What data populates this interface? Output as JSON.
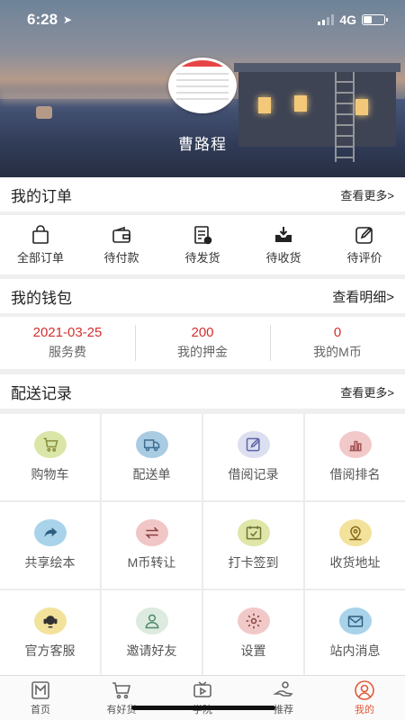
{
  "status_bar": {
    "time": "6:28",
    "network": "4G"
  },
  "profile": {
    "name": "曹路程"
  },
  "orders": {
    "title": "我的订单",
    "more": "查看更多>",
    "items": [
      {
        "label": "全部订单",
        "icon": "bag-icon"
      },
      {
        "label": "待付款",
        "icon": "wallet-icon"
      },
      {
        "label": "待发货",
        "icon": "shipping-list-icon"
      },
      {
        "label": "待收货",
        "icon": "inbox-download-icon"
      },
      {
        "label": "待评价",
        "icon": "edit-review-icon"
      }
    ]
  },
  "wallet": {
    "title": "我的钱包",
    "more": "查看明细>",
    "items": [
      {
        "value": "2021-03-25",
        "label": "服务费"
      },
      {
        "value": "200",
        "label": "我的押金"
      },
      {
        "value": "0",
        "label": "我的M币"
      }
    ]
  },
  "delivery": {
    "title": "配送记录",
    "more": "查看更多>",
    "items": [
      {
        "label": "购物车",
        "icon": "cart-icon",
        "color": "#d9e6a8"
      },
      {
        "label": "配送单",
        "icon": "truck-icon",
        "color": "#a9cce3"
      },
      {
        "label": "借阅记录",
        "icon": "pencil-icon",
        "color": "#dcdff0"
      },
      {
        "label": "借阅排名",
        "icon": "ranking-icon",
        "color": "#f2c9c9"
      },
      {
        "label": "共享绘本",
        "icon": "share-icon",
        "color": "#a9d3ea"
      },
      {
        "label": "M币转让",
        "icon": "transfer-icon",
        "color": "#f1c6c6"
      },
      {
        "label": "打卡签到",
        "icon": "checkin-icon",
        "color": "#dfe6a8"
      },
      {
        "label": "收货地址",
        "icon": "location-icon",
        "color": "#f3e29c"
      },
      {
        "label": "官方客服",
        "icon": "headset-icon",
        "color": "#f3e29c"
      },
      {
        "label": "邀请好友",
        "icon": "friends-icon",
        "color": "#ddeadf"
      },
      {
        "label": "设置",
        "icon": "gear-icon",
        "color": "#f2c9c9"
      },
      {
        "label": "站内消息",
        "icon": "mail-icon",
        "color": "#a9d3ea"
      }
    ]
  },
  "tabbar": {
    "items": [
      {
        "label": "首页",
        "icon": "home-icon"
      },
      {
        "label": "有好货",
        "icon": "cart-icon"
      },
      {
        "label": "学院",
        "icon": "tv-icon"
      },
      {
        "label": "推荐",
        "icon": "recommend-icon"
      },
      {
        "label": "我的",
        "icon": "profile-icon"
      }
    ],
    "active_color": "#e25a3a"
  }
}
